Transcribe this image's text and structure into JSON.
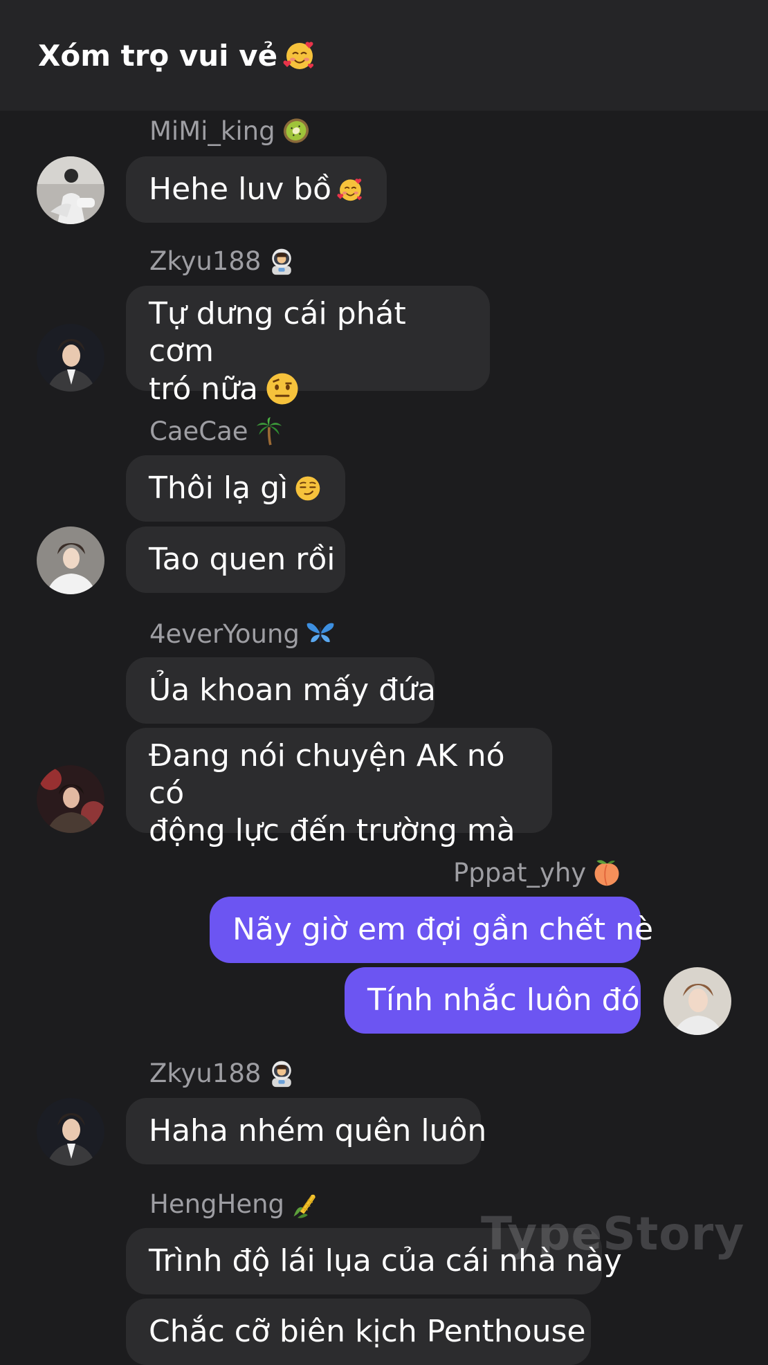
{
  "chat": {
    "title": "Xóm trọ vui vẻ",
    "title_emoji": "smiling-face-with-hearts"
  },
  "messages": [
    {
      "sender": "MiMi_king",
      "sender_emoji": "kiwi",
      "text": "Hehe luv bồ",
      "emoji": "smiling-face-with-hearts"
    },
    {
      "sender": "Zkyu188",
      "sender_emoji": "astronaut",
      "text_lines": [
        "Tự dưng cái phát cơm",
        "tró nữa"
      ],
      "emoji": "face-with-raised-eyebrow"
    },
    {
      "sender": "CaeCae",
      "sender_emoji": "palm-tree",
      "texts": [
        "Thôi lạ gì",
        "Tao quen rồi"
      ],
      "emoji": "smirking-face"
    },
    {
      "sender": "4everYoung",
      "sender_emoji": "butterfly",
      "texts": [
        "Ủa khoan mấy đứa"
      ],
      "text_lines": [
        "Đang nói chuyện AK nó có",
        "động lực đến trường mà"
      ]
    },
    {
      "sender": "Pppat_yhy",
      "sender_emoji": "peach",
      "texts": [
        "Nãy giờ em đợi gần chết nè",
        "Tính nhắc luôn đó"
      ],
      "is_mine": true
    },
    {
      "sender": "Zkyu188",
      "sender_emoji": "astronaut",
      "texts": [
        "Haha nhém quên luôn"
      ]
    },
    {
      "sender": "HengHeng",
      "sender_emoji": "corn",
      "texts": [
        "Trình độ lái lụa của cái nhà này",
        "Chắc cỡ biên kịch Penthouse"
      ]
    }
  ],
  "watermark": "TypeStory",
  "colors": {
    "background": "#1c1c1e",
    "header": "#252527",
    "bubble_other": "#2c2c2e",
    "bubble_mine": "#6c55f2",
    "name_text": "#9e9ea3"
  }
}
